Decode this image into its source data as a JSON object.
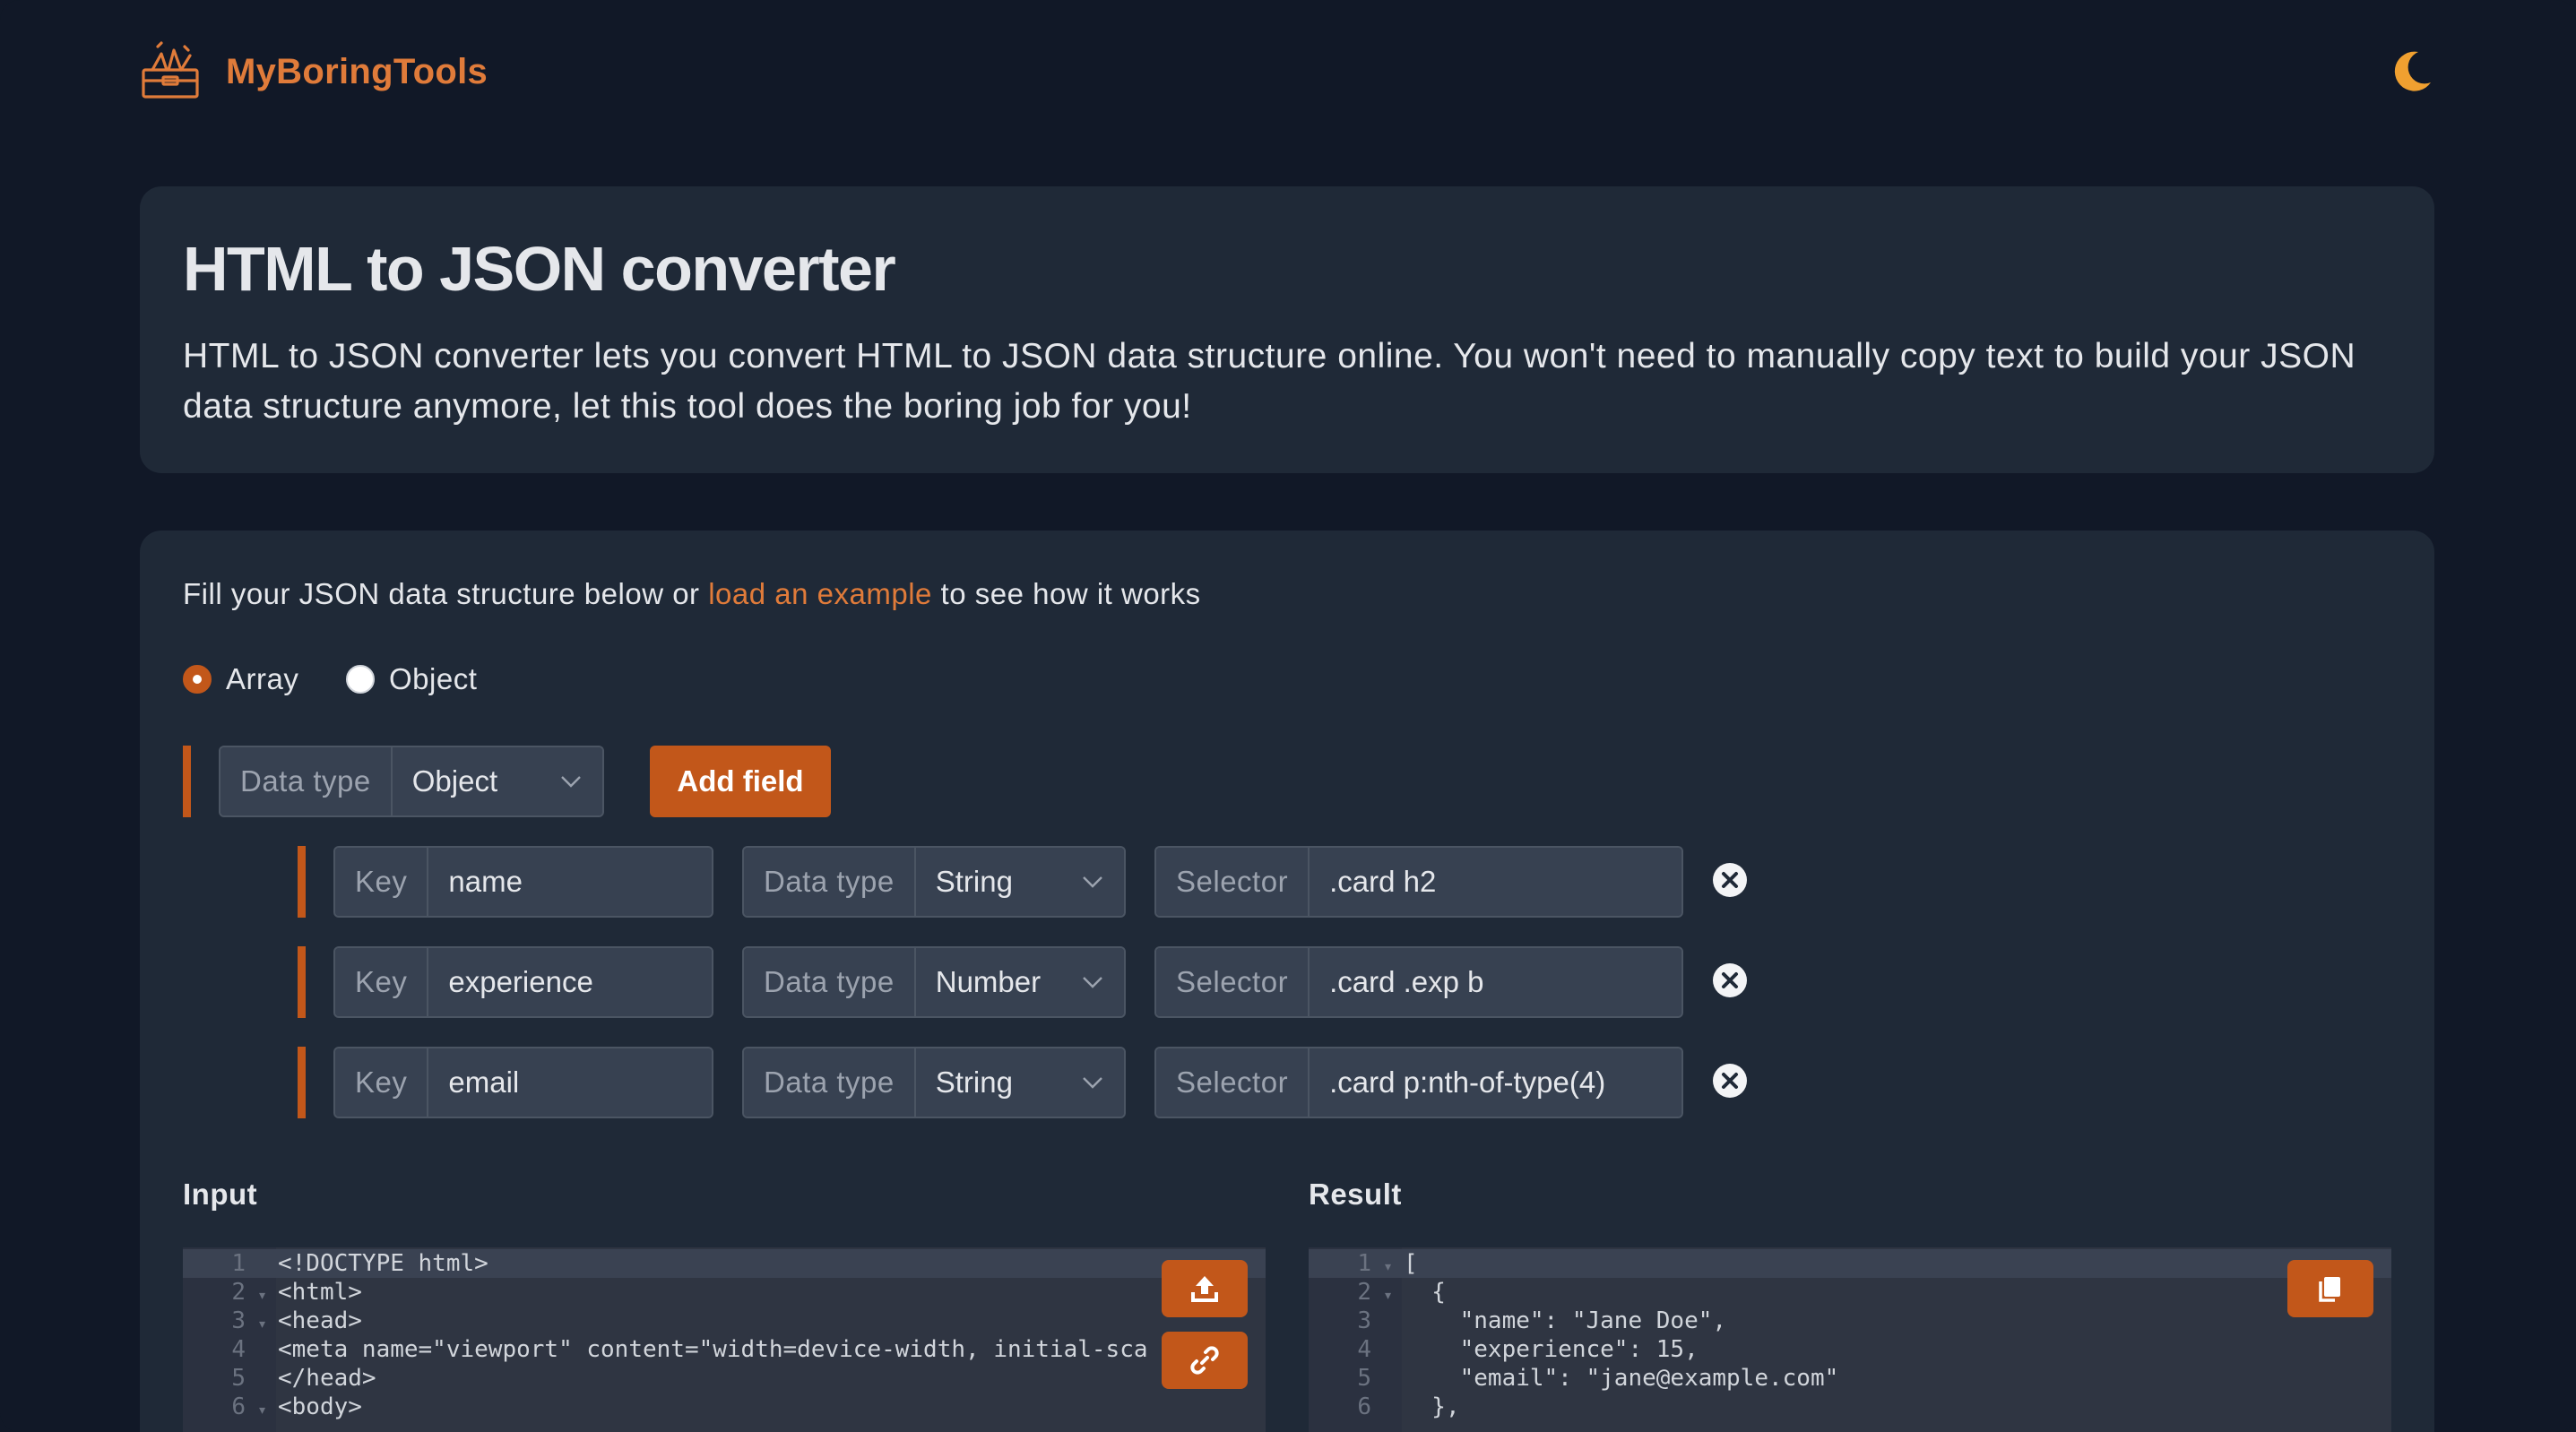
{
  "header": {
    "brand": "MyBoringTools",
    "logo_icon": "toolbox-icon",
    "theme_icon": "moon-icon",
    "accent_color": "#e07b3a"
  },
  "intro": {
    "title": "HTML to JSON converter",
    "description": "HTML to JSON converter lets you convert HTML to JSON data structure online. You won't need to manually copy text to build your JSON data structure anymore, let this tool does the boring job for you!"
  },
  "builder": {
    "hint_before": "Fill your JSON data structure below or ",
    "hint_link": "load an example",
    "hint_after": " to see how it works",
    "structure_options": [
      {
        "label": "Array",
        "selected": true
      },
      {
        "label": "Object",
        "selected": false
      }
    ],
    "root": {
      "data_type_label": "Data type",
      "data_type_value": "Object",
      "add_field_label": "Add field"
    },
    "fields": [
      {
        "key_label": "Key",
        "key": "name",
        "type_label": "Data type",
        "type": "String",
        "selector_label": "Selector",
        "selector": ".card h2"
      },
      {
        "key_label": "Key",
        "key": "experience",
        "type_label": "Data type",
        "type": "Number",
        "selector_label": "Selector",
        "selector": ".card .exp b"
      },
      {
        "key_label": "Key",
        "key": "email",
        "type_label": "Data type",
        "type": "String",
        "selector_label": "Selector",
        "selector": ".card p:nth-of-type(4)"
      }
    ]
  },
  "input": {
    "label": "Input",
    "line_numbers": [
      "1",
      "2",
      "3",
      "4",
      "5",
      "6"
    ],
    "lines": [
      "<!DOCTYPE html>",
      "<html>",
      "<head>",
      "<meta name=\"viewport\" content=\"width=device-width, initial-sca",
      "</head>",
      "<body>"
    ],
    "upload_icon": "upload-icon",
    "link_icon": "link-icon"
  },
  "result": {
    "label": "Result",
    "line_numbers": [
      "1",
      "2",
      "3",
      "4",
      "5",
      "6"
    ],
    "lines": [
      "[",
      "  {",
      "    \"name\": \"Jane Doe\",",
      "    \"experience\": 15,",
      "    \"email\": \"jane@example.com\"",
      "  },"
    ],
    "copy_icon": "copy-icon"
  }
}
